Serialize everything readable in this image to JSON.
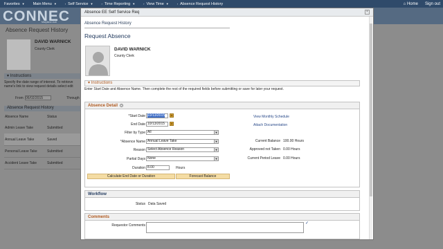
{
  "topnav": {
    "items": [
      "Favorites",
      "Main Menu",
      "Self Service",
      "Time Reporting",
      "View Time",
      "Absence Request History"
    ],
    "home": "Home",
    "signout": "Sign out"
  },
  "banner": {
    "logo": "CONNEC",
    "sub": "Maryland Judi"
  },
  "background": {
    "title": "Absence Request History",
    "employee_name": "DAVID WARNICK",
    "employee_role": "County Clerk",
    "instructions_label": "Instructions",
    "instructions_text_1": "Specify the date range of interest. To retrieve",
    "instructions_text_2": "name's link to view request details select edit",
    "from_label": "From",
    "from_value": "06/02/2015",
    "through_label": "Through",
    "history_label": "Absence Request History",
    "col_name": "Absence Name",
    "col_status": "Status",
    "rows": [
      {
        "name": "Admin Leave Take",
        "status": "Submitted"
      },
      {
        "name": "Annual Leave Take",
        "status": "Saved"
      },
      {
        "name": "Personal Leave Take",
        "status": "Submitted"
      },
      {
        "name": "Accident Leave Take",
        "status": "Submitted"
      }
    ]
  },
  "modal": {
    "title": "Absence EE Self Service Req",
    "close_label": "×",
    "breadcrumb": "Absence Request History",
    "page_title": "Request Absence",
    "employee_name": "DAVID WARNICK",
    "employee_role": "County Clerk",
    "instructions_label": "Instructions",
    "instructions_text": "Enter Start Date and Absence Name. Then complete the rest of the required fields before submitting or save for later your request.",
    "detail_label": "Absence Detail",
    "start_date_label": "*Start Date",
    "start_date_value": "10/13/2015",
    "end_date_label": "End Date",
    "end_date_value": "10/13/2015",
    "filter_label": "Filter by Type",
    "filter_value": "All",
    "absence_name_label": "*Absence Name",
    "absence_name_value": "Annual Leave Take",
    "reason_label": "Reason",
    "reason_value": "Select Absence Reason",
    "partial_label": "Partial Days",
    "partial_value": "None",
    "duration_label": "Duration",
    "duration_value": "8.00",
    "duration_unit": "Hours",
    "link_schedule": "View Monthly Schedule",
    "link_attach": "Attach Documentation",
    "current_balance_label": "Current Balance",
    "current_balance_value": "100.00 Hours",
    "approved_label": "Approved not Taken",
    "approved_value": "0.00 Hours",
    "period_label": "Current Period Leave",
    "period_value": "0.00 Hours",
    "btn_calc": "Calculate End Date or Duration",
    "btn_forecast": "Forecast Balance",
    "workflow_label": "Workflow",
    "status_label": "Status",
    "status_value": "Data Saved",
    "comments_label": "Comments",
    "requestor_label": "Requestor Comments"
  }
}
